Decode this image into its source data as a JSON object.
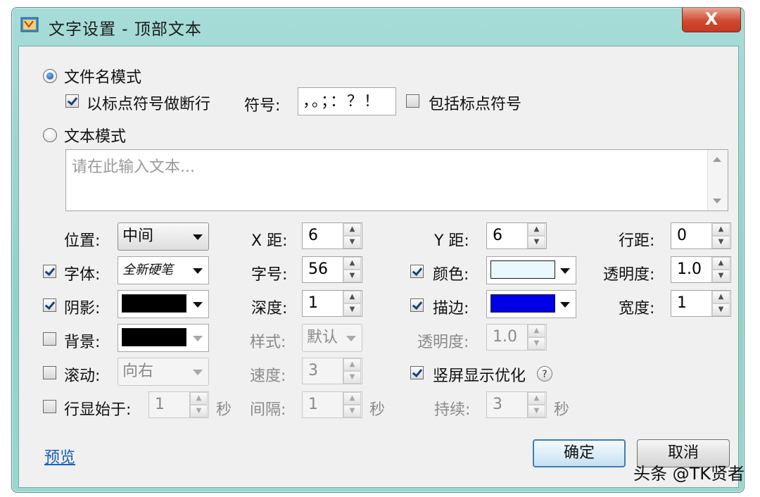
{
  "window": {
    "title": "文字设置 - 顶部文本",
    "close_glyph": "X"
  },
  "filename_mode": {
    "label": "文件名模式",
    "selected": true
  },
  "punct_break": {
    "label": "以标点符号做断行",
    "checked": true
  },
  "symbol": {
    "label": "符号:",
    "value": "，。；：？！"
  },
  "include_punct": {
    "label": "包括标点符号",
    "checked": false
  },
  "text_mode": {
    "label": "文本模式",
    "selected": false
  },
  "text_input": {
    "placeholder": "请在此输入文本..."
  },
  "position": {
    "label": "位置:",
    "value": "中间"
  },
  "x_dist": {
    "label": "X 距:",
    "value": "6"
  },
  "y_dist": {
    "label": "Y 距:",
    "value": "6"
  },
  "line_spacing": {
    "label": "行距:",
    "value": "0"
  },
  "font": {
    "label": "字体:",
    "value": "全新硬笔",
    "checked": true
  },
  "font_size": {
    "label": "字号:",
    "value": "56"
  },
  "color": {
    "label": "颜色:",
    "checked": true,
    "swatch": "#eaf8fb"
  },
  "opacity": {
    "label": "透明度:",
    "value": "1.0"
  },
  "shadow": {
    "label": "阴影:",
    "checked": true,
    "swatch": "#000000"
  },
  "depth": {
    "label": "深度:",
    "value": "1"
  },
  "stroke": {
    "label": "描边:",
    "checked": true,
    "swatch": "#0000e6"
  },
  "stroke_width": {
    "label": "宽度:",
    "value": "1"
  },
  "background": {
    "label": "背景:",
    "checked": false,
    "swatch": "#000000"
  },
  "bg_style": {
    "label": "样式:",
    "value": "默认"
  },
  "bg_opacity": {
    "label": "透明度:",
    "value": "1.0"
  },
  "scroll": {
    "label": "滚动:",
    "checked": false,
    "value": "向右"
  },
  "speed": {
    "label": "速度:",
    "value": "3"
  },
  "vertical_opt": {
    "label": "竖屏显示优化",
    "checked": true,
    "help": "?"
  },
  "line_show": {
    "label": "行显始于:",
    "checked": false,
    "value": "1",
    "unit": "秒"
  },
  "interval": {
    "label": "间隔:",
    "value": "1",
    "unit": "秒"
  },
  "duration": {
    "label": "持续:",
    "value": "3",
    "unit": "秒"
  },
  "preview_link": "预览",
  "ok_button": "确定",
  "cancel_button": "取消",
  "watermark": "头条 @TK贤者"
}
